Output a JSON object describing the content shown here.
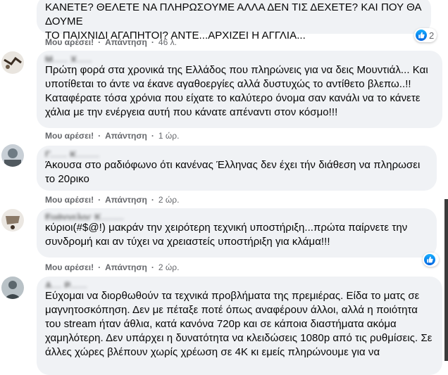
{
  "comments": [
    {
      "author": "",
      "text": "ΚΑΝΕΤΕ? ΘΕΛΕΤΕ ΝΑ ΠΛΗΡΩΣΟΥΜΕ ΑΛΛΑ ΔΕΝ ΤΙΣ ΔΕΧΕΤΕ? ΚΑΙ ΠΟΥ ΘΑ ΔΟΥΜΕ\nΤΟ ΠΑΙΧΝΙΔΙ ΑΓΑΠΗΤΟΙ? ΑΝΤΕ...ΑΡΧΙΖΕΙ Η ΑΓΓΛΙΑ...",
      "like_label": "Μου αρέσει!",
      "reply_label": "Απάντηση",
      "time": "46 λ.",
      "reaction_count": "2"
    },
    {
      "author": "Μ...... Χ......",
      "text": "Πρώτη φορά στα χρονικά της Ελλάδος που πληρώνεις για να δεις Μουντιάλ... Και\nυποτίθεται το άντε να έκανε αγαθοεργίες αλλά δυστυχώς το αντίθετο βλεπω..!!\nΚαταφέρατε τόσα χρόνια που είχατε το καλύτερο όνομα σαν κανάλι να το κάνετε\nχάλια με την ενέργεια αυτή που κάνατε απέναντι στον κόσμο!!!",
      "like_label": "Μου αρέσει!",
      "reply_label": "Απάντηση",
      "time": "1 ώρ."
    },
    {
      "author": "Γ....... Κ.........",
      "text": "Άκουσα στο ραδιόφωνο ότι κανένας Έλληνας δεν έχει τήν διάθεση να πληρωσει\nτο 20ρικο",
      "like_label": "Μου αρέσει!",
      "reply_label": "Απάντηση",
      "time": "2 ώρ."
    },
    {
      "author": "Ευάγγελος Κ.........",
      "text": "κύριοι(#$@!) μακράν την χειρότερη τεχνική υποστήριξη...πρώτα παίρνετε την\nσυνδρομή και αν τύχει να χρειαστείς υποστήριξη για κλάμα!!!",
      "like_label": "Μου αρέσει!",
      "reply_label": "Απάντηση",
      "time": "2 ώρ.",
      "reaction_count": ""
    },
    {
      "author": "Α.... Ρ.......",
      "text": "Εύχομαι να διορθωθούν τα τεχνικά προβλήματα της πρεμιέρας. Είδα το ματς σε\nμαγνητοσκόπηση. Δεν με πέταξε ποτέ όπως αναφέρουν άλλοι, αλλά η ποιότητα\nτου stream ήταν άθλια, κατά κανόνα 720p και σε κάποια διαστήματα ακόμα\nχαμηλότερη. Δεν υπάρχει η δυνατότητα να κλειδώσεις 1080p από τις ρυθμίσεις. Σε\nάλλες χώρες βλέπουν χωρίς χρέωση σε 4K κι εμείς πληρώνουμε για να"
    }
  ],
  "colors": {
    "bubble": "#f0f2f5",
    "meta": "#65676b",
    "like_blue": "#1877f2"
  }
}
